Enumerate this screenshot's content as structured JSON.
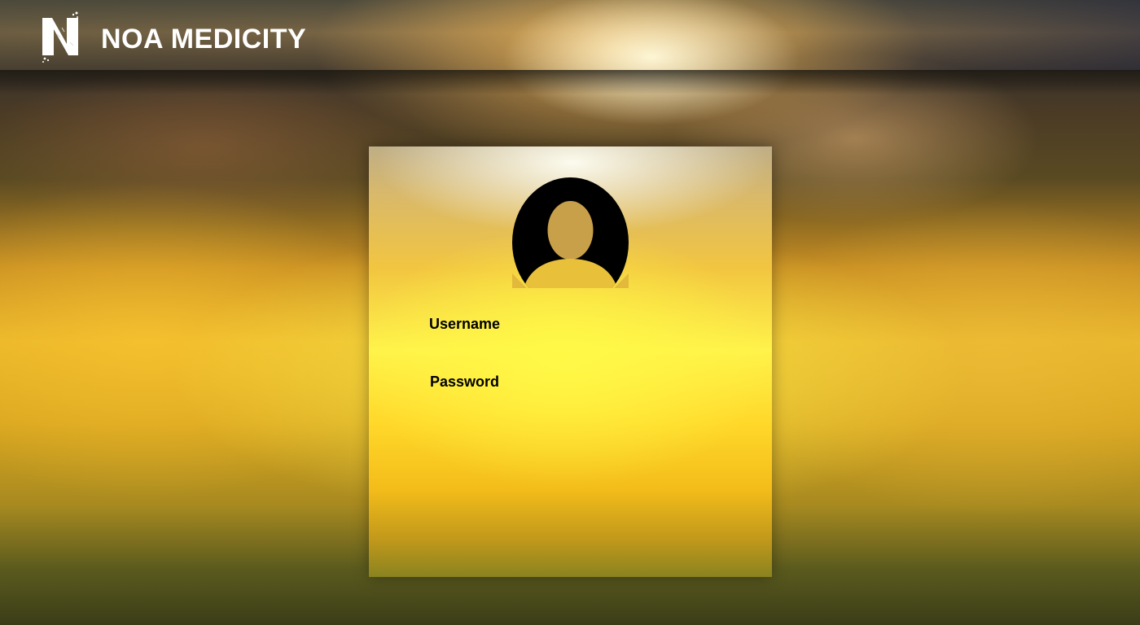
{
  "brand": {
    "name": "NOA MEDICITY",
    "logo_icon": "n-logo-icon"
  },
  "login": {
    "avatar_icon": "user-avatar-icon",
    "username_label": "Username",
    "password_label": "Password",
    "username_value": "",
    "password_value": ""
  },
  "colors": {
    "brand_text": "#ffffff",
    "label_text": "#000000",
    "card_accent": "#fff24a"
  }
}
